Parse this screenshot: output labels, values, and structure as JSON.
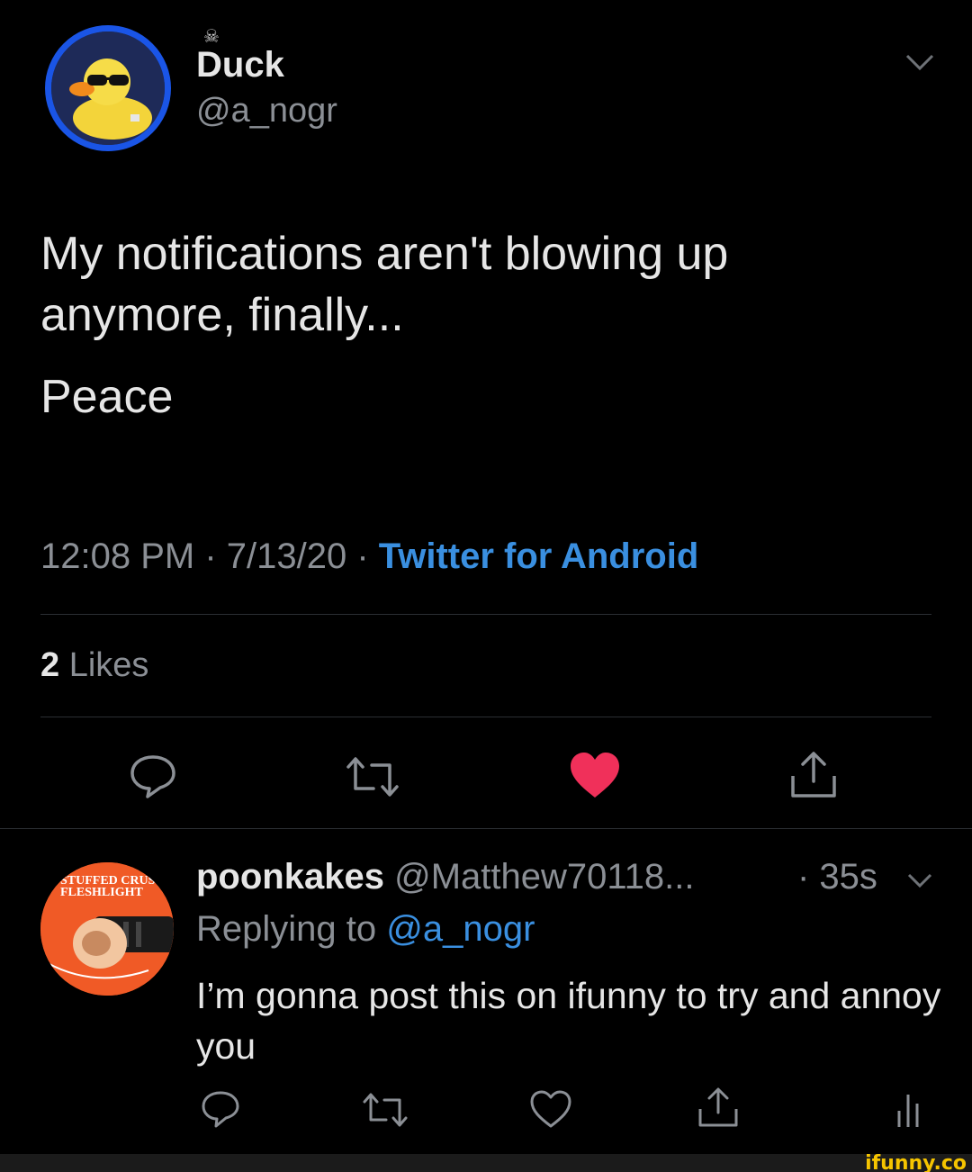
{
  "tweet": {
    "author": {
      "name_tag": "☠",
      "display_name": "Duck",
      "handle": "@a_nogr"
    },
    "text_lines": [
      "My notifications aren't blowing up anymore, finally...",
      "Peace"
    ],
    "time": "12:08 PM",
    "date": "7/13/20",
    "source": "Twitter for Android",
    "separator": " · ",
    "likes_count": "2",
    "likes_label": " Likes",
    "liked": true
  },
  "reply": {
    "author": {
      "display_name": "poonkakes",
      "handle": "@Matthew70118...",
      "avatar_text_top": "STUFFED CRUST",
      "avatar_text_bottom": "FLESHLIGHT"
    },
    "time": "· 35s",
    "replying_prefix": "Replying to ",
    "replying_to": "@a_nogr",
    "text": "I’m gonna post this on ifunny to try and annoy you"
  },
  "watermark": "ifunny.co",
  "colors": {
    "background": "#000000",
    "accent_blue": "#3a8fe0",
    "like_red": "#f0305a",
    "muted": "#8b8f95",
    "avatar_ring": "#1a55e6"
  }
}
